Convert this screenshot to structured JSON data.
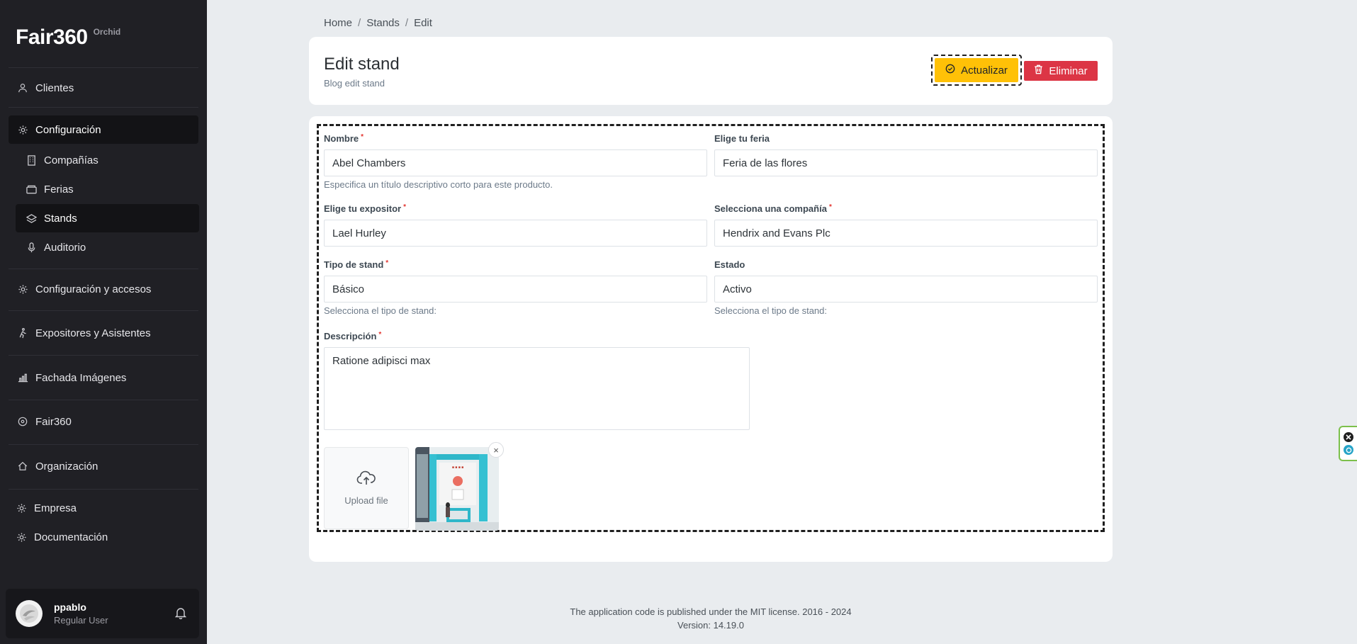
{
  "brand": {
    "name": "Fair360",
    "tag": "Orchid"
  },
  "sidebar": {
    "items": [
      {
        "label": "Clientes",
        "icon": "person-icon"
      },
      {
        "label": "Configuración",
        "icon": "gear-icon",
        "active": true
      },
      {
        "label": "Compañías",
        "icon": "building-icon"
      },
      {
        "label": "Ferias",
        "icon": "wallet-icon"
      },
      {
        "label": "Stands",
        "icon": "layers-icon",
        "active": true
      },
      {
        "label": "Auditorio",
        "icon": "microphone-icon"
      },
      {
        "label": "Configuración y accesos",
        "icon": "gear-icon"
      },
      {
        "label": "Expositores y Asistentes",
        "icon": "walking-person-icon"
      },
      {
        "label": "Fachada Imágenes",
        "icon": "bar-chart-icon"
      },
      {
        "label": "Fair360",
        "icon": "circle-icon"
      },
      {
        "label": "Organización",
        "icon": "home-icon"
      },
      {
        "label": "Empresa",
        "icon": "gear-icon"
      },
      {
        "label": "Documentación",
        "icon": "gear-icon"
      }
    ],
    "user": {
      "name": "ppablo",
      "role": "Regular User"
    }
  },
  "breadcrumb": [
    "Home",
    "Stands",
    "Edit"
  ],
  "header": {
    "title": "Edit stand",
    "subtitle": "Blog edit stand",
    "update_label": "Actualizar",
    "delete_label": "Eliminar"
  },
  "form": {
    "nombre": {
      "label": "Nombre",
      "value": "Abel Chambers",
      "help": "Especifica un título descriptivo corto para este producto."
    },
    "feria": {
      "label": "Elige tu feria",
      "value": "Feria de las flores"
    },
    "expositor": {
      "label": "Elige tu expositor",
      "value": "Lael Hurley"
    },
    "compania": {
      "label": "Selecciona una compañía",
      "value": "Hendrix and Evans Plc"
    },
    "tipo": {
      "label": "Tipo de stand",
      "value": "Básico",
      "help": "Selecciona el tipo de stand:"
    },
    "estado": {
      "label": "Estado",
      "value": "Activo",
      "help": "Selecciona el tipo de stand:"
    },
    "descripcion": {
      "label": "Descripción",
      "value": "Ratione adipisci max"
    },
    "upload_label": "Upload file",
    "required_mark": "*",
    "remove_mark": "×"
  },
  "footer": {
    "license": "The application code is published under the MIT license. 2016 - 2024",
    "version": "Version: 14.19.0"
  },
  "colors": {
    "sidebar_bg": "#202025",
    "update_button": "#ffc107",
    "delete_button": "#dc3545",
    "required": "#e3342f"
  }
}
